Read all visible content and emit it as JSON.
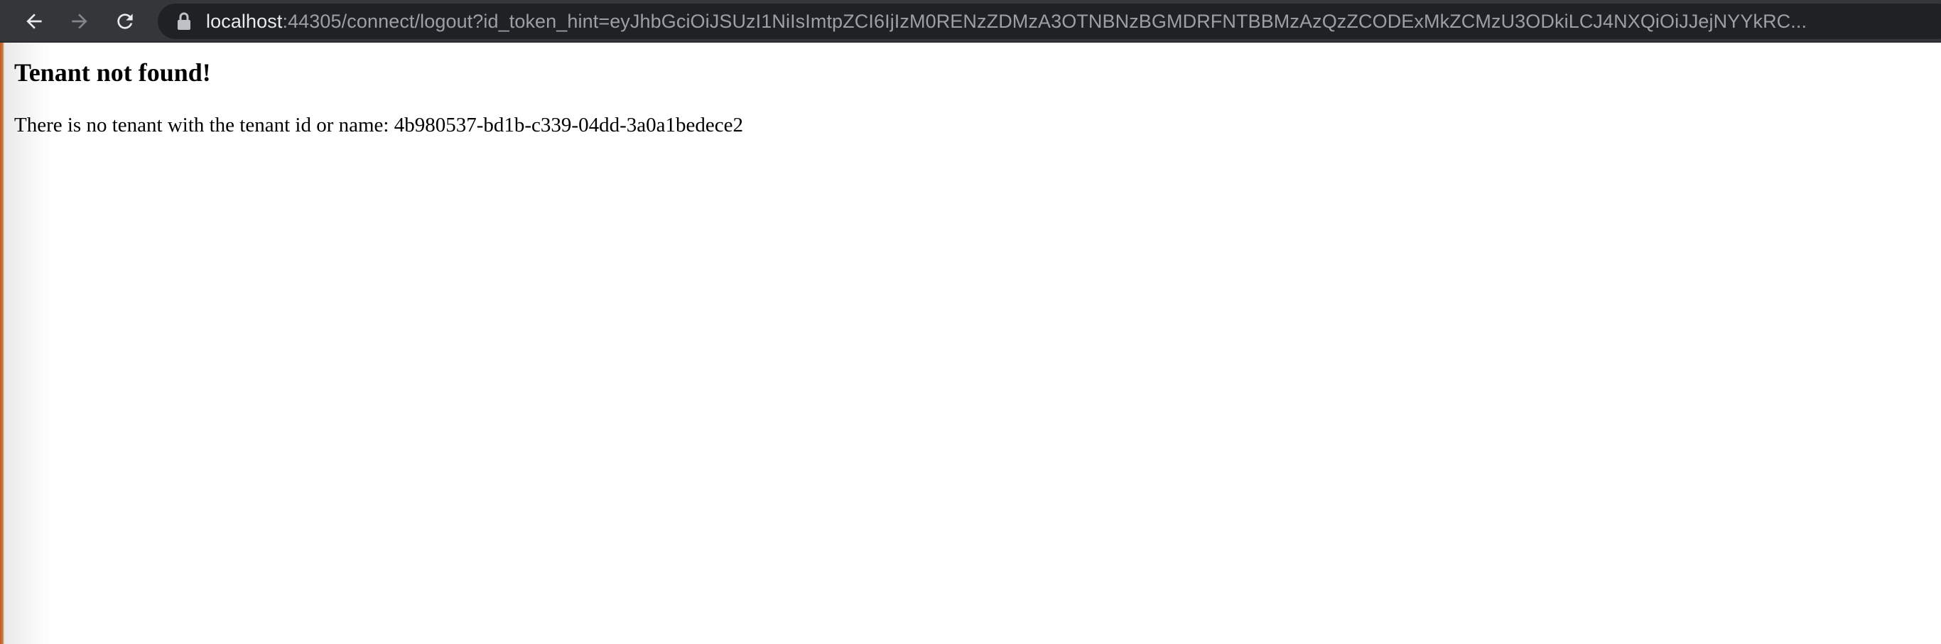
{
  "browser": {
    "url_host": "localhost",
    "url_rest": ":44305/connect/logout?id_token_hint=eyJhbGciOiJSUzI1NiIsImtpZCI6IjIzM0RENzZDMzA3OTNBNzBGMDRFNTBBMzAzQzZCODExMkZCMzU3ODkiLCJ4NXQiOiJJejNYYkRC...",
    "back_icon": "arrow-left",
    "forward_icon": "arrow-right",
    "reload_icon": "reload",
    "lock_icon": "lock"
  },
  "page": {
    "heading": "Tenant not found!",
    "message": "There is no tenant with the tenant id or name: 4b980537-bd1b-c339-04dd-3a0a1bedece2"
  },
  "colors": {
    "toolbar_bg": "#35363a",
    "omnibox_bg": "#202124",
    "url_host": "#e8eaed",
    "url_rest": "#9aa0a6",
    "icon_active": "#e8eaed",
    "icon_disabled": "#80868b"
  }
}
